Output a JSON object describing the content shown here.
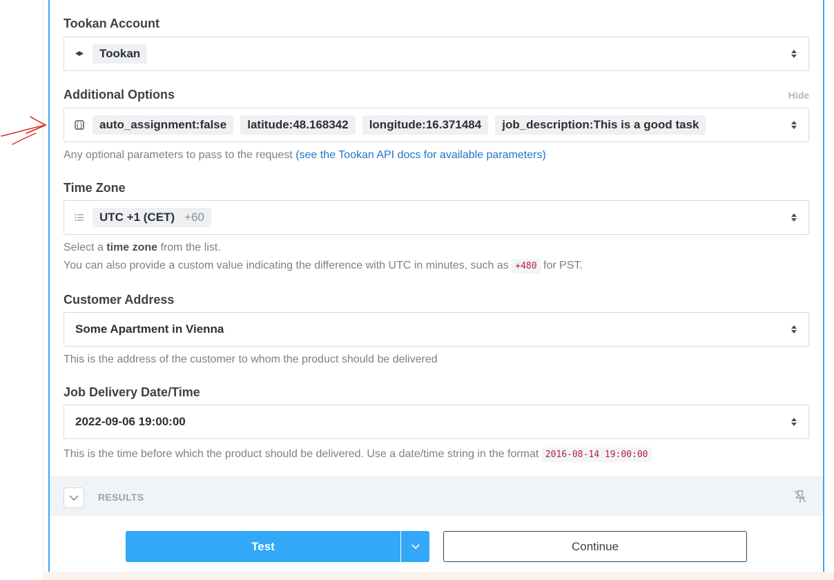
{
  "tookan_account": {
    "label": "Tookan Account",
    "value": "Tookan",
    "icon": "tookan-logo-icon"
  },
  "additional_options": {
    "label": "Additional Options",
    "hide_label": "Hide",
    "icon": "object-icon",
    "chips": [
      "auto_assignment:false",
      "latitude:48.168342",
      "longitude:16.371484",
      "job_description:This is a good task"
    ],
    "help_text": "Any optional parameters to pass to the request ",
    "help_link": "(see the Tookan API docs for available parameters)"
  },
  "time_zone": {
    "label": "Time Zone",
    "icon": "list-icon",
    "value": "UTC +1 (CET)",
    "value_sub": "+60",
    "help_line1_prefix": "Select a ",
    "help_line1_bold": "time zone",
    "help_line1_suffix": " from the list.",
    "help_line2_prefix": "You can also provide a custom value indicating the difference with UTC in minutes, such as ",
    "help_line2_code": "+480",
    "help_line2_suffix": " for PST."
  },
  "customer_address": {
    "label": "Customer Address",
    "value": "Some Apartment in Vienna",
    "help_text": "This is the address of the customer to whom the product should be delivered"
  },
  "job_delivery": {
    "label": "Job Delivery Date/Time",
    "value": "2022-09-06 19:00:00",
    "help_prefix": "This is the time before which the product should be delivered. Use a date/time string in the format ",
    "help_code": "2016-08-14 19:00:00"
  },
  "results": {
    "label": "RESULTS"
  },
  "actions": {
    "test_label": "Test",
    "continue_label": "Continue"
  },
  "colors": {
    "accent": "#33a7f8",
    "panel_border": "#3aa6f5",
    "annotation": "#e0231b"
  }
}
